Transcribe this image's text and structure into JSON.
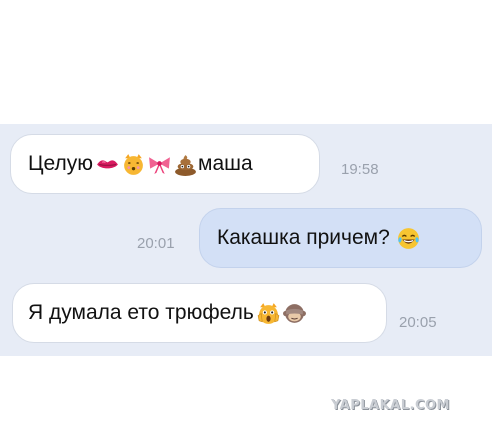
{
  "messages": [
    {
      "text": "Целую",
      "emojis": [
        "kiss-lips-icon",
        "kissing-cat-icon",
        "ribbon-bow-icon",
        "poop-icon"
      ],
      "text_after": "маша",
      "time": "19:58",
      "side": "incoming"
    },
    {
      "text": "Какашка причем?",
      "emojis": [
        "tears-of-joy-icon"
      ],
      "time": "20:01",
      "side": "outgoing"
    },
    {
      "text": "Я думала ето трюфель",
      "emojis": [
        "screaming-cat-icon",
        "see-no-evil-monkey-icon"
      ],
      "time": "20:05",
      "side": "incoming"
    }
  ],
  "watermark": "YAPLAKAL.COM",
  "colors": {
    "chat_background": "#e7ecf6",
    "incoming_bubble": "#ffffff",
    "outgoing_bubble": "#d3e0f6",
    "timestamp": "#9aa1ad"
  }
}
